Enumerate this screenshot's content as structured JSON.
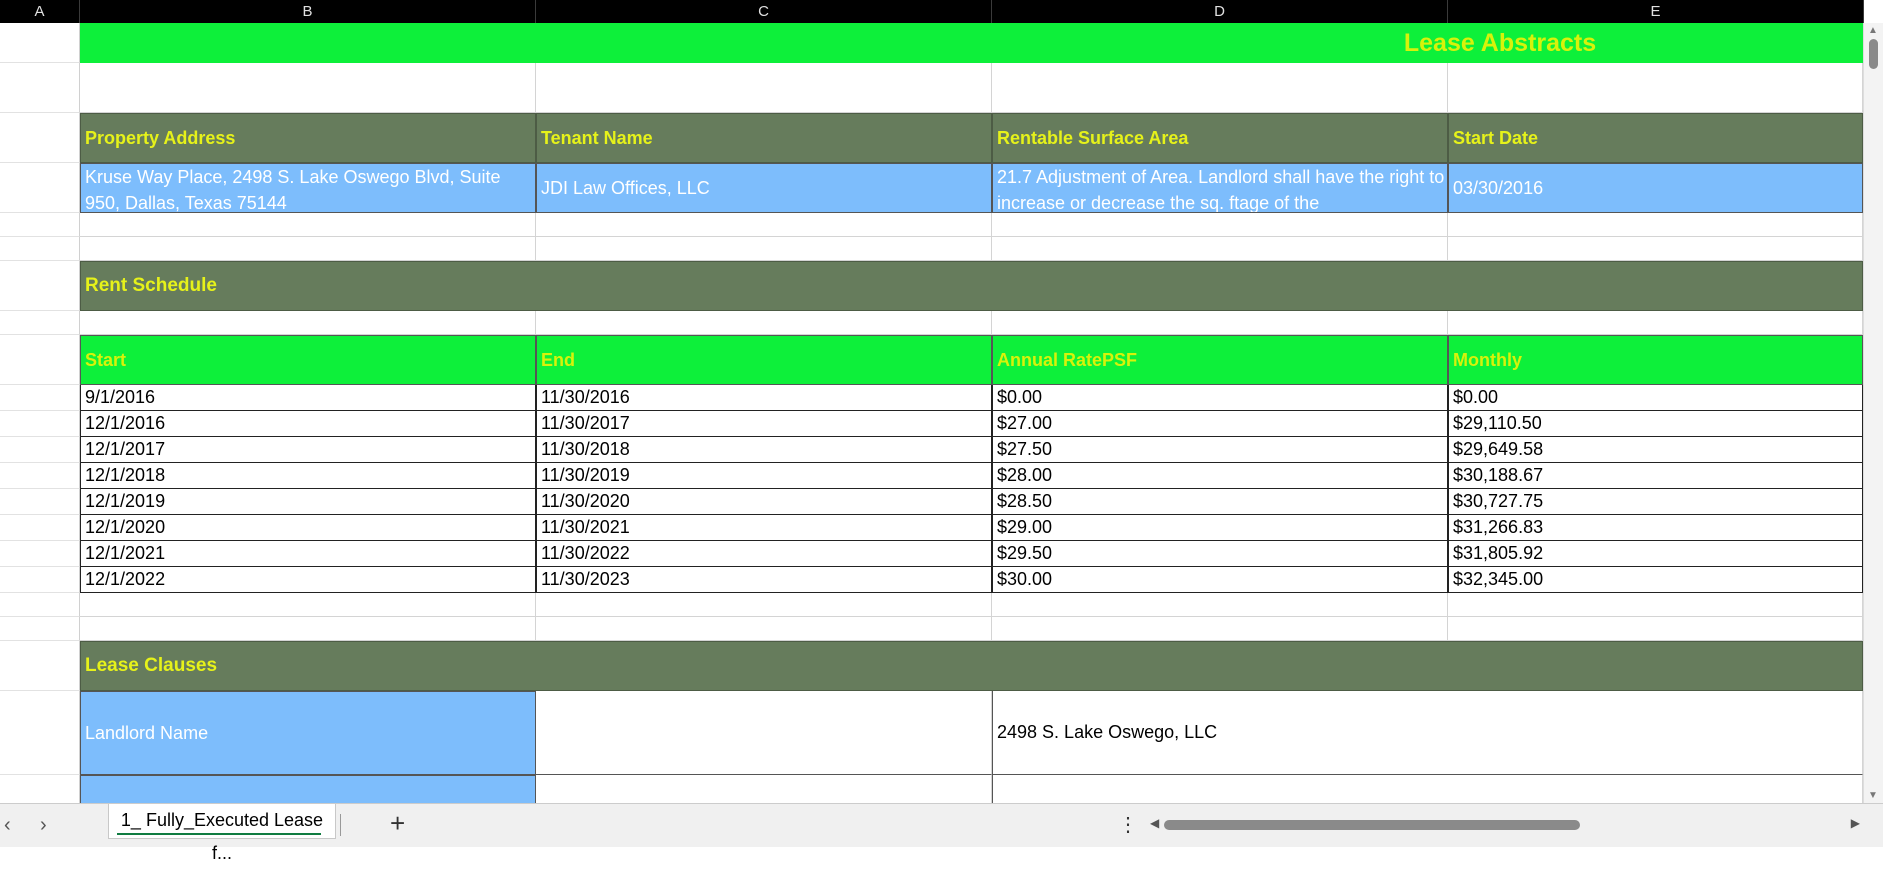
{
  "columns": [
    "A",
    "B",
    "C",
    "D",
    "E"
  ],
  "title": "Lease Abstracts",
  "property": {
    "headers": [
      "Property Address",
      "Tenant Name",
      "Rentable Surface Area",
      "Start Date"
    ],
    "address": "Kruse Way Place, 2498 S. Lake Oswego Blvd, Suite 950, Dallas, Texas 75144",
    "tenant": "JDI Law Offices, LLC",
    "area": "21.7  Adjustment of  Area.  Landlord shall have the right to increase or decrease the  sq. ftage of the",
    "start_date": "03/30/2016"
  },
  "rent_schedule": {
    "title": "Rent Schedule",
    "headers": [
      "Start",
      "End",
      "Annual RatePSF",
      "Monthly"
    ],
    "rows": [
      [
        "9/1/2016",
        "11/30/2016",
        "$0.00",
        "$0.00"
      ],
      [
        "12/1/2016",
        "11/30/2017",
        "$27.00",
        "$29,110.50"
      ],
      [
        "12/1/2017",
        "11/30/2018",
        "$27.50",
        "$29,649.58"
      ],
      [
        "12/1/2018",
        "11/30/2019",
        "$28.00",
        "$30,188.67"
      ],
      [
        "12/1/2019",
        "11/30/2020",
        "$28.50",
        "$30,727.75"
      ],
      [
        "12/1/2020",
        "11/30/2021",
        "$29.00",
        "$31,266.83"
      ],
      [
        "12/1/2021",
        "11/30/2022",
        "$29.50",
        "$31,805.92"
      ],
      [
        "12/1/2022",
        "11/30/2023",
        "$30.00",
        "$32,345.00"
      ]
    ]
  },
  "lease_clauses": {
    "title": "Lease Clauses",
    "landlord_label": "Landlord Name",
    "landlord_value": "2498 S. Lake Oswego, LLC"
  },
  "sheet_tab": "1_ Fully_Executed Lease f...",
  "icons": {
    "prev": "chevron-left-icon",
    "next": "chevron-right-icon",
    "add": "plus-icon",
    "more": "more-vertical-icon"
  },
  "colors": {
    "olive": "#667c5c",
    "bright_green": "#0df03a",
    "yellow_text": "#d8f20a",
    "blue": "#7dbdfc"
  }
}
